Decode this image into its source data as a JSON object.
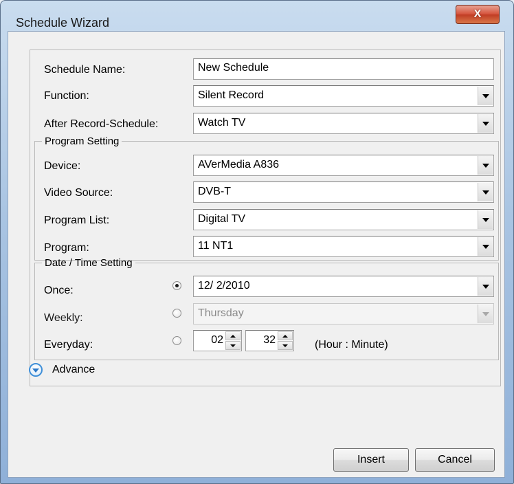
{
  "window": {
    "title": "Schedule Wizard",
    "close_glyph": "X"
  },
  "general": {
    "schedule_name_label": "Schedule Name:",
    "schedule_name_value": "New Schedule",
    "function_label": "Function:",
    "function_value": "Silent Record",
    "after_record_label": "After Record-Schedule:",
    "after_record_value": "Watch TV"
  },
  "program_setting": {
    "legend": "Program Setting",
    "device_label": "Device:",
    "device_value": "AVerMedia A836",
    "video_source_label": "Video Source:",
    "video_source_value": "DVB-T",
    "program_list_label": "Program List:",
    "program_list_value": "Digital TV",
    "program_label": "Program:",
    "program_value": "11 NT1"
  },
  "datetime_setting": {
    "legend": "Date / Time Setting",
    "once_label": "Once:",
    "once_value": "12/  2/2010",
    "once_selected": true,
    "weekly_label": "Weekly:",
    "weekly_value": "Thursday",
    "everyday_label": "Everyday:",
    "hour_value": "02",
    "minute_value": "32",
    "hour_minute_hint": "(Hour : Minute)"
  },
  "advance": {
    "label": "Advance"
  },
  "buttons": {
    "insert": "Insert",
    "cancel": "Cancel"
  }
}
